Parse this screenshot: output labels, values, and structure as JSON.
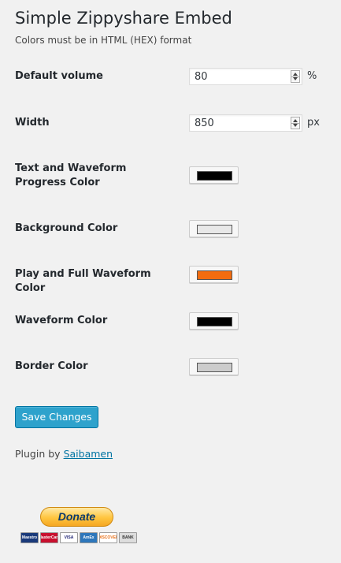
{
  "page": {
    "title": "Simple Zippyshare Embed",
    "subtitle": "Colors must be in HTML (HEX) format"
  },
  "settings": {
    "default_volume": {
      "label": "Default volume",
      "value": "80",
      "unit": "%"
    },
    "width": {
      "label": "Width",
      "value": "850",
      "unit": "px"
    },
    "text_waveform_progress_color": {
      "label": "Text and Waveform Progress Color",
      "color": "#000000"
    },
    "background_color": {
      "label": "Background Color",
      "color": "#e8e8e8"
    },
    "play_full_waveform_color": {
      "label": "Play and Full Waveform Color",
      "color": "#f26c0f"
    },
    "waveform_color": {
      "label": "Waveform Color",
      "color": "#000000"
    },
    "border_color": {
      "label": "Border Color",
      "color": "#cccccc"
    }
  },
  "actions": {
    "save_label": "Save Changes"
  },
  "footer": {
    "plugin_by": "Plugin by",
    "author": "Saibamen"
  },
  "donate": {
    "label": "Donate",
    "cards": [
      "Maestro",
      "MasterCard",
      "VISA",
      "AmEx",
      "DISCOVER",
      "BANK"
    ]
  },
  "colors": {
    "accent": "#2ea2cc",
    "link": "#0074a2",
    "background": "#f1f1f1"
  }
}
